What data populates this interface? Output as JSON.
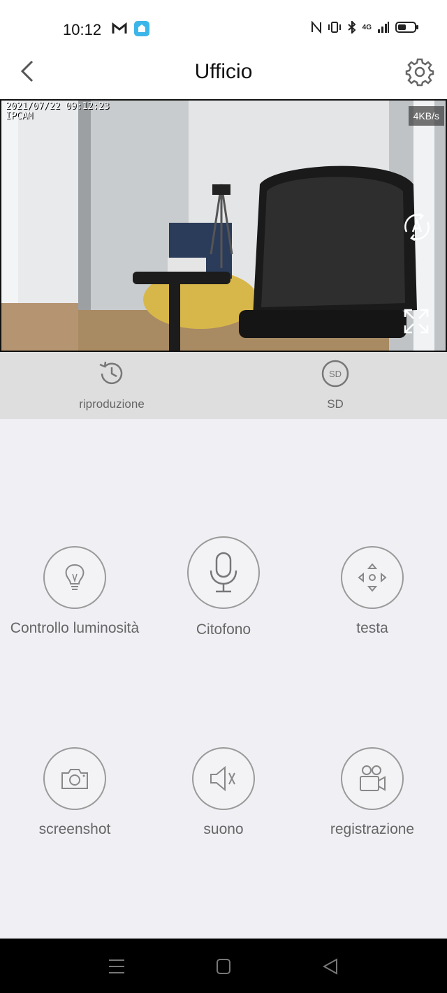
{
  "status_bar": {
    "time": "10:12",
    "network": "4G"
  },
  "header": {
    "title": "Ufficio"
  },
  "video": {
    "osd_timestamp": "2021/07/22 09:12:23",
    "osd_name": "IPCAM",
    "bitrate": "4KB/s"
  },
  "sub_toolbar": {
    "playback_label": "riproduzione",
    "sd_label": "SD",
    "sd_icon_text": "SD"
  },
  "controls": {
    "brightness_label": "Controllo luminosità",
    "intercom_label": "Citofono",
    "ptz_label": "testa",
    "screenshot_label": "screenshot",
    "sound_label": "suono",
    "record_label": "registrazione"
  },
  "colors": {
    "icon_gray": "#8a8a8a",
    "label_gray": "#666666",
    "background": "#efeff4",
    "toolbar": "#dedede"
  }
}
